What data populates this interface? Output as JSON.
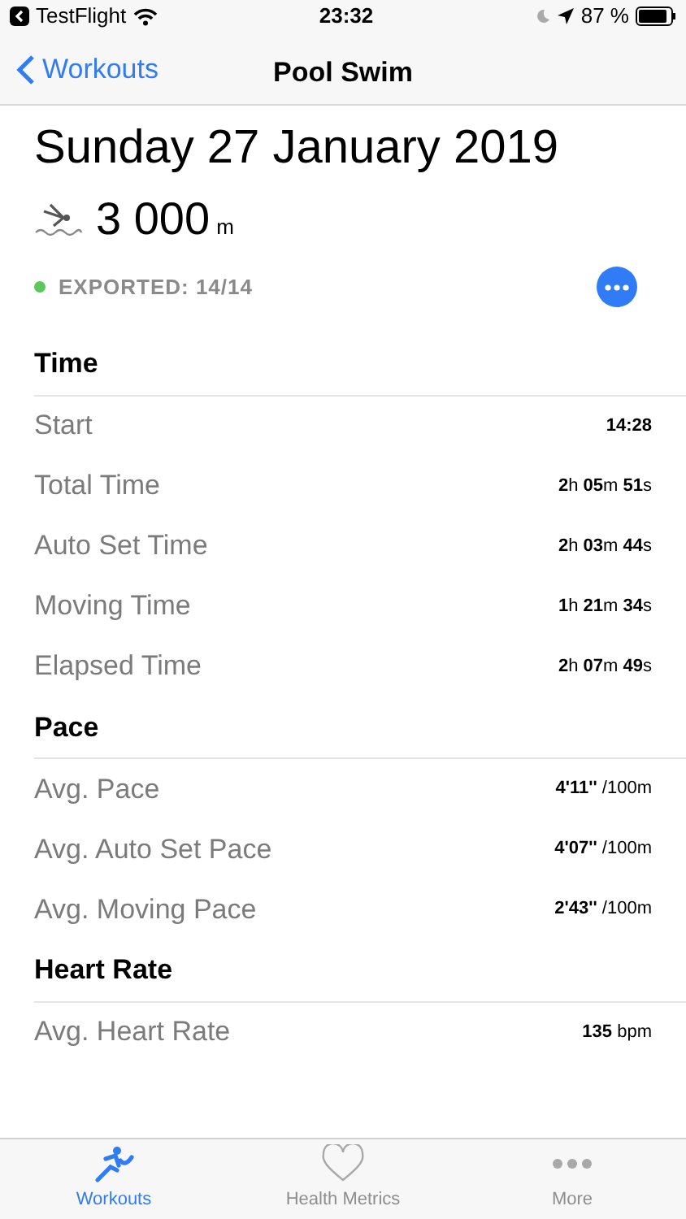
{
  "status_bar": {
    "back_app": "TestFlight",
    "time": "23:32",
    "battery": "87 %"
  },
  "nav": {
    "back": "Workouts",
    "title": "Pool Swim"
  },
  "date": "Sunday 27 January 2019",
  "distance": {
    "value": "3 000",
    "unit": "m"
  },
  "export": {
    "label": "EXPORTED: 14/14",
    "color": "#5ac85a"
  },
  "sections": [
    {
      "title": "Time",
      "rows": [
        {
          "label": "Start",
          "value": "**14:28**"
        },
        {
          "label": "Total Time",
          "value": "**2**h **05**m **51**s"
        },
        {
          "label": "Auto Set Time",
          "value": "**2**h **03**m **44**s"
        },
        {
          "label": "Moving Time",
          "value": "**1**h **21**m **34**s"
        },
        {
          "label": "Elapsed Time",
          "value": "**2**h **07**m **49**s"
        }
      ]
    },
    {
      "title": "Pace",
      "rows": [
        {
          "label": "Avg. Pace",
          "value": "**4'11''** /100m"
        },
        {
          "label": "Avg. Auto Set Pace",
          "value": "**4'07''** /100m"
        },
        {
          "label": "Avg. Moving Pace",
          "value": "**2'43''** /100m"
        }
      ]
    },
    {
      "title": "Heart Rate",
      "rows": [
        {
          "label": "Avg. Heart Rate",
          "value": "**135** bpm"
        }
      ]
    }
  ],
  "tabs": [
    {
      "label": "Workouts",
      "selected": true
    },
    {
      "label": "Health Metrics",
      "selected": false
    },
    {
      "label": "More",
      "selected": false
    }
  ]
}
